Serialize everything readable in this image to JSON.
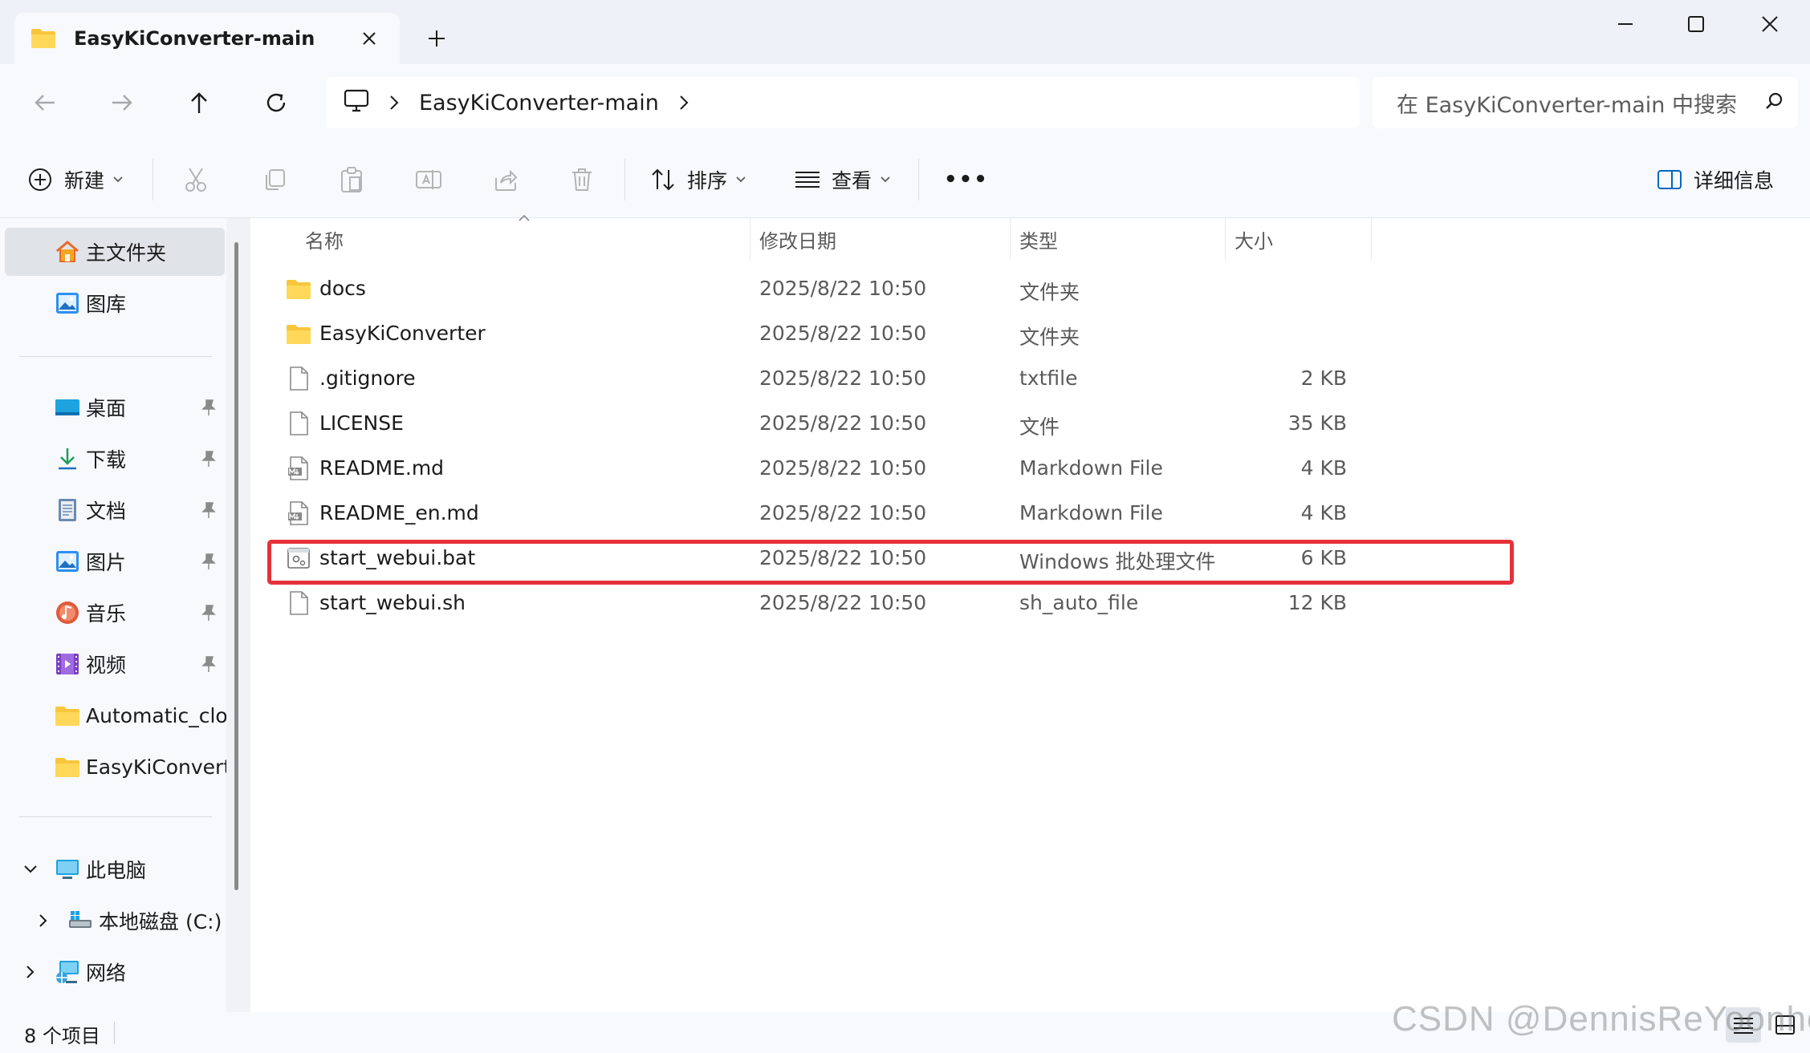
{
  "window": {
    "tab_title": "EasyKiConverter-main",
    "new_tab_label": "+",
    "accent": "#0067c0",
    "folder_color": "#f8c63c",
    "highlight_color": "#e5323a"
  },
  "address": {
    "root_icon": "this-pc-icon",
    "crumbs": [
      "EasyKiConverter-main"
    ],
    "search_placeholder": "在 EasyKiConverter-main 中搜索"
  },
  "toolbar": {
    "new_label": "新建",
    "sort_label": "排序",
    "view_label": "查看",
    "more_label": "•••",
    "details_label": "详细信息"
  },
  "sidebar": {
    "home_label": "主文件夹",
    "gallery_label": "图库",
    "quick_access": [
      {
        "label": "桌面",
        "icon": "desktop-icon"
      },
      {
        "label": "下载",
        "icon": "download-icon"
      },
      {
        "label": "文档",
        "icon": "documents-icon"
      },
      {
        "label": "图片",
        "icon": "pictures-icon"
      },
      {
        "label": "音乐",
        "icon": "music-icon"
      },
      {
        "label": "视频",
        "icon": "videos-icon"
      }
    ],
    "folders": [
      {
        "label": "Automatic_cloc"
      },
      {
        "label": "EasyKiConverte"
      }
    ],
    "this_pc_label": "此电脑",
    "local_disk_label": "本地磁盘 (C:)",
    "network_label": "网络"
  },
  "columns": {
    "name": "名称",
    "date": "修改日期",
    "type": "类型",
    "size": "大小"
  },
  "files": [
    {
      "name": "docs",
      "date": "2025/8/22 10:50",
      "type": "文件夹",
      "size": "",
      "icon": "folder-icon"
    },
    {
      "name": "EasyKiConverter",
      "date": "2025/8/22 10:50",
      "type": "文件夹",
      "size": "",
      "icon": "folder-icon"
    },
    {
      "name": ".gitignore",
      "date": "2025/8/22 10:50",
      "type": "txtfile",
      "size": "2 KB",
      "icon": "file-icon"
    },
    {
      "name": "LICENSE",
      "date": "2025/8/22 10:50",
      "type": "文件",
      "size": "35 KB",
      "icon": "file-icon"
    },
    {
      "name": "README.md",
      "date": "2025/8/22 10:50",
      "type": "Markdown File",
      "size": "4 KB",
      "icon": "markdown-file-icon"
    },
    {
      "name": "README_en.md",
      "date": "2025/8/22 10:50",
      "type": "Markdown File",
      "size": "4 KB",
      "icon": "markdown-file-icon"
    },
    {
      "name": "start_webui.bat",
      "date": "2025/8/22 10:50",
      "type": "Windows 批处理文件",
      "size": "6 KB",
      "icon": "batch-file-icon"
    },
    {
      "name": "start_webui.sh",
      "date": "2025/8/22 10:50",
      "type": "sh_auto_file",
      "size": "12 KB",
      "icon": "file-icon"
    }
  ],
  "status": {
    "item_count": "8 个项目"
  },
  "watermark": "CSDN @DennisReYoonho"
}
